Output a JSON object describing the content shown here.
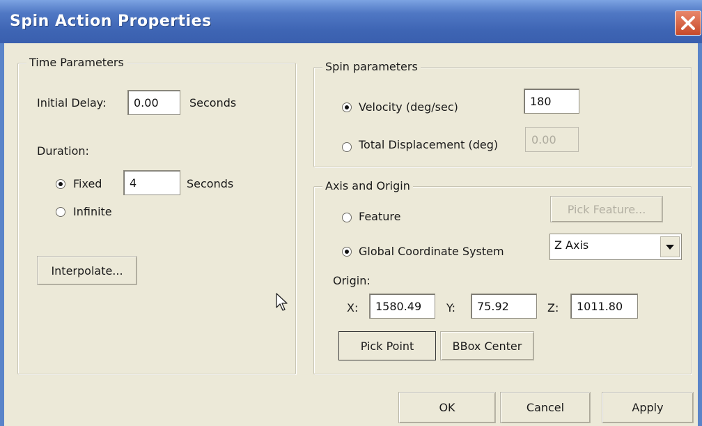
{
  "window": {
    "title": "Spin Action Properties"
  },
  "time_parameters": {
    "legend": "Time Parameters",
    "initial_delay_label": "Initial Delay:",
    "initial_delay_value": "0.00",
    "initial_delay_unit": "Seconds",
    "duration_label": "Duration:",
    "fixed_label": "Fixed",
    "fixed_value": "4",
    "fixed_unit": "Seconds",
    "infinite_label": "Infinite",
    "duration_selected": "Fixed",
    "interpolate_button": "Interpolate..."
  },
  "spin_parameters": {
    "legend": "Spin parameters",
    "velocity_label": "Velocity (deg/sec)",
    "velocity_value": "180",
    "total_displacement_label": "Total Displacement (deg)",
    "total_displacement_value": "0.00",
    "selected": "Velocity (deg/sec)"
  },
  "axis_origin": {
    "legend": "Axis and Origin",
    "feature_label": "Feature",
    "pick_feature_button": "Pick Feature...",
    "global_label": "Global Coordinate System",
    "axis_select_value": "Z Axis",
    "selected": "Global Coordinate System",
    "origin_label": "Origin:",
    "x_label": "X:",
    "x_value": "1580.49",
    "y_label": "Y:",
    "y_value": "75.92",
    "z_label": "Z:",
    "z_value": "1011.80",
    "pick_point_button": "Pick Point",
    "bbox_center_button": "BBox Center"
  },
  "footer": {
    "ok_button": "OK",
    "cancel_button": "Cancel",
    "apply_button": "Apply"
  },
  "icons": {
    "close": "close-icon",
    "dropdown": "chevron-down-icon",
    "cursor": "mouse-pointer-icon"
  },
  "colors": {
    "titlebar": "#3e65b4",
    "close_button": "#c74a2a",
    "dialog_background": "#ece9d8"
  }
}
